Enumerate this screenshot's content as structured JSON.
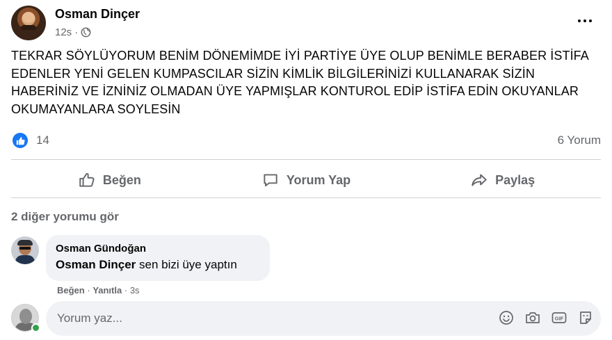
{
  "post": {
    "author": "Osman Dinçer",
    "time": "12s",
    "privacy_icon": "globe-icon",
    "text": "TEKRAR SÖYLÜYORUM BENİM DÖNEMİMDE İYİ PARTİYE ÜYE OLUP BENİMLE BERABER İSTİFA EDENLER YENİ GELEN KUMPASCILAR SİZİN KİMLİK BİLGİLERİNİZİ KULLANARAK SİZİN HABERİNİZ VE İZNİNİZ OLMADAN ÜYE YAPMIŞLAR KONTUROL EDİP İSTİFA EDİN OKUYANLAR OKUMAYANLARA SOYLESİN",
    "reactions_count": "14",
    "comments_count": "6 Yorum"
  },
  "actions": {
    "like_label": "Beğen",
    "comment_label": "Yorum Yap",
    "share_label": "Paylaş"
  },
  "more_comments_label": "2 diğer yorumu gör",
  "comment": {
    "author": "Osman Gündoğan",
    "mention": "Osman Dinçer",
    "text": " sen bizi üye yaptın",
    "like_label": "Beğen",
    "reply_label": "Yanıtla",
    "time": "3s"
  },
  "composer": {
    "placeholder": "Yorum yaz...",
    "icons": [
      "emoji-icon",
      "camera-icon",
      "gif-icon",
      "sticker-icon"
    ]
  },
  "colors": {
    "brand": "#1877f2",
    "secondary_text": "#65676b",
    "bubble_bg": "#f0f2f5",
    "online": "#31a24c"
  }
}
